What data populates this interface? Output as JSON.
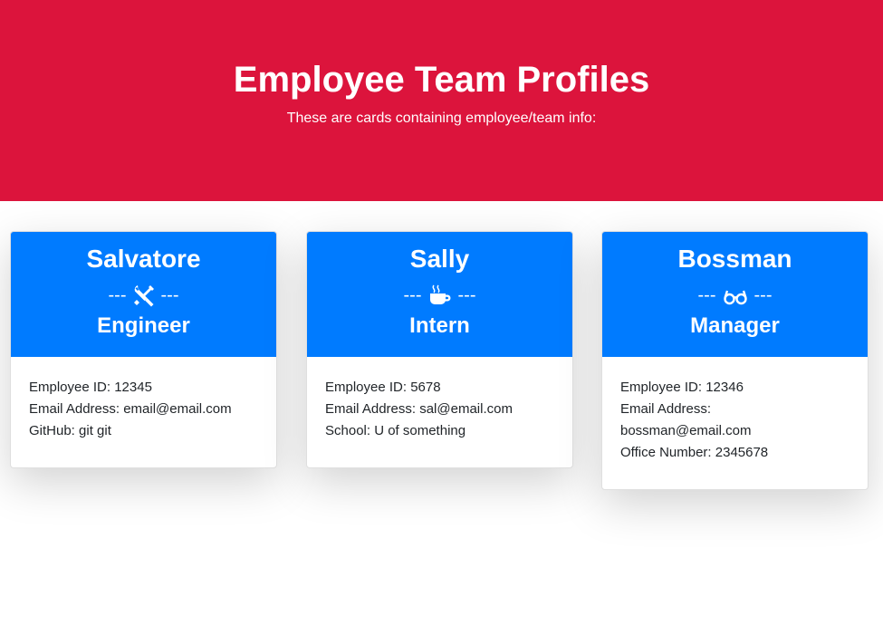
{
  "header": {
    "title": "Employee Team Profiles",
    "subtitle": "These are cards containing employee/team info:"
  },
  "colors": {
    "hero_bg": "#dc143c",
    "card_header_bg": "#007bff"
  },
  "cards": [
    {
      "name": "Salvatore",
      "separator_left": "---",
      "separator_right": "---",
      "icon": "tools-icon",
      "role": "Engineer",
      "lines": [
        "Employee ID: 12345",
        "Email Address: email@email.com",
        "GitHub: git git"
      ]
    },
    {
      "name": "Sally",
      "separator_left": "---",
      "separator_right": "---",
      "icon": "coffee-cup-icon",
      "role": "Intern",
      "lines": [
        "Employee ID: 5678",
        "Email Address: sal@email.com",
        "School: U of something"
      ]
    },
    {
      "name": "Bossman",
      "separator_left": "---",
      "separator_right": "---",
      "icon": "glasses-icon",
      "role": "Manager",
      "lines": [
        "Employee ID: 12346",
        "Email Address:",
        "bossman@email.com",
        "Office Number: 2345678"
      ]
    }
  ]
}
